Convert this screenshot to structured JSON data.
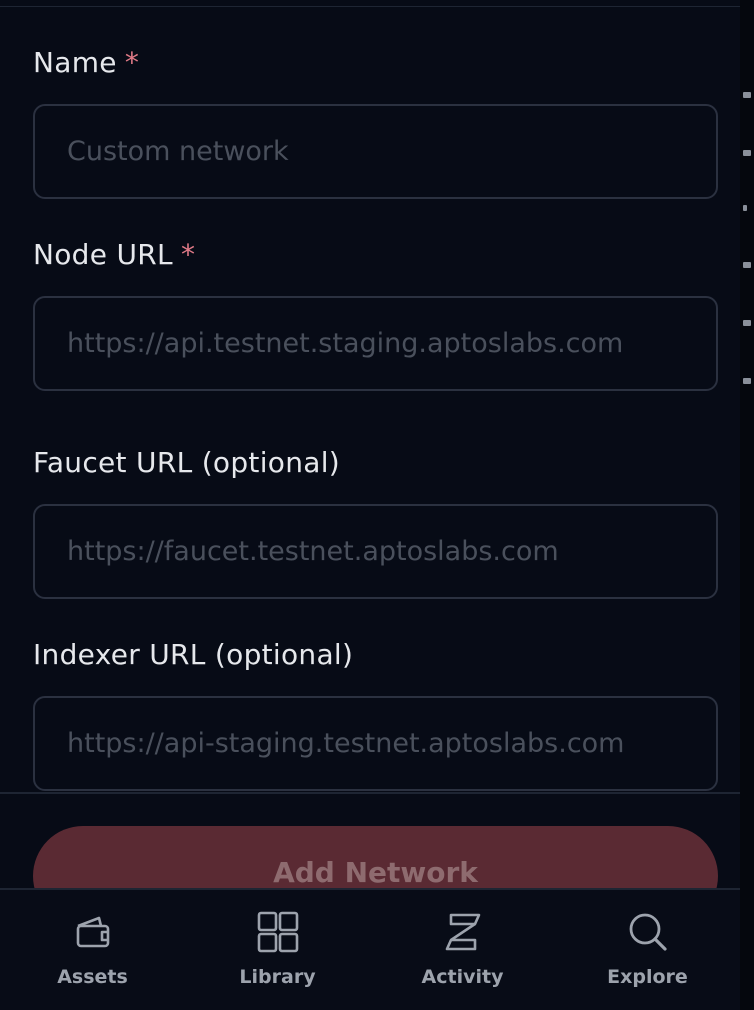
{
  "form": {
    "name": {
      "label": "Name",
      "required_mark": "*",
      "placeholder": "Custom network"
    },
    "node_url": {
      "label": "Node URL",
      "required_mark": "*",
      "placeholder": "https://api.testnet.staging.aptoslabs.com"
    },
    "faucet_url": {
      "label": "Faucet URL (optional)",
      "placeholder": "https://faucet.testnet.aptoslabs.com"
    },
    "indexer_url": {
      "label": "Indexer URL (optional)",
      "placeholder": "https://api-staging.testnet.aptoslabs.com"
    }
  },
  "add_button": {
    "label": "Add Network"
  },
  "tabs": [
    {
      "label": "Assets",
      "icon": "wallet-icon"
    },
    {
      "label": "Library",
      "icon": "grid-icon"
    },
    {
      "label": "Activity",
      "icon": "activity-icon"
    },
    {
      "label": "Explore",
      "icon": "search-icon"
    }
  ],
  "colors": {
    "background": "#070b16",
    "required": "#e07a87",
    "button_bg": "#5a2a33",
    "button_text": "#8e6b6f",
    "tab_label": "#9da3ad"
  }
}
